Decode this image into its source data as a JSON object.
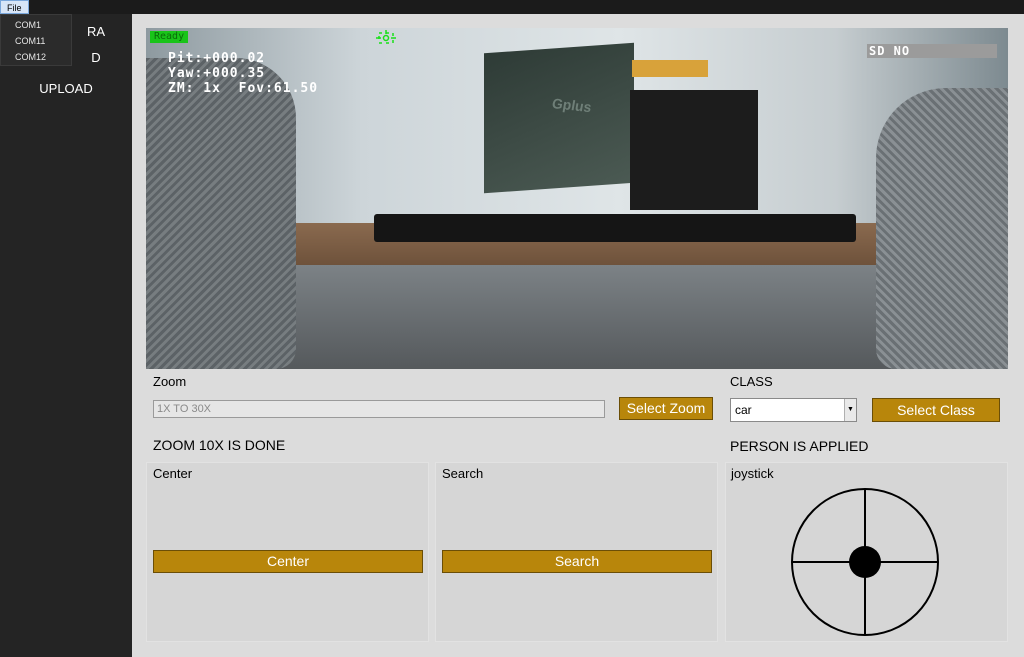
{
  "menu": {
    "file_label": "File",
    "com_ports": [
      "COM1",
      "COM11",
      "COM12"
    ]
  },
  "sidebar": {
    "items": [
      {
        "label": "RA"
      },
      {
        "label": "D"
      },
      {
        "label": "UPLOAD"
      }
    ]
  },
  "camera": {
    "status": "Ready",
    "pitch": "Pit:+000.02",
    "yaw": "Yaw:+000.35",
    "zoom_fov": "ZM: 1x  Fov:61.50",
    "sd_status": "SD NO",
    "monitor_brand": "Gplus"
  },
  "zoom": {
    "label": "Zoom",
    "placeholder": "1X TO 30X",
    "button_label": "Select Zoom",
    "status": "ZOOM 10X IS DONE"
  },
  "class_panel": {
    "label": "CLASS",
    "selected": "car",
    "button_label": "Select Class",
    "status": "PERSON IS APPLIED"
  },
  "center_panel": {
    "label": "Center",
    "button_label": "Center"
  },
  "search_panel": {
    "label": "Search",
    "button_label": "Search"
  },
  "joystick_panel": {
    "label": "joystick"
  },
  "colors": {
    "accent": "#b8860b",
    "panel_bg": "#dcdcdc",
    "sidebar_bg": "#242424"
  }
}
